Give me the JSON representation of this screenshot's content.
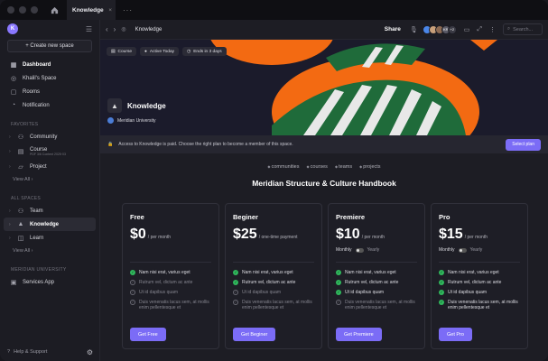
{
  "titlebar": {
    "tab_label": "Knowledge",
    "tab_close": "×",
    "more": "···"
  },
  "sidebar": {
    "avatar_letter": "K",
    "create_label": "+  Create new space",
    "main_items": [
      {
        "label": "Dashboard",
        "icon": "dashboard-icon",
        "glyph": "▦"
      },
      {
        "label": "Khalil's Space",
        "icon": "compass-icon",
        "glyph": "◎"
      },
      {
        "label": "Rooms",
        "icon": "door-icon",
        "glyph": "▢"
      },
      {
        "label": "Notification",
        "icon": "bell-icon",
        "glyph": "◔"
      }
    ],
    "favorites_label": "FAVORITES",
    "favorites": [
      {
        "label": "Community",
        "icon": "users-icon",
        "glyph": "⚇"
      },
      {
        "label": "Course",
        "sub": "PDF 3/6 Content 2025·03",
        "icon": "book-icon",
        "glyph": "▤"
      },
      {
        "label": "Project",
        "icon": "folder-icon",
        "glyph": "▱"
      }
    ],
    "view_all_1": "View All  ›",
    "spaces_label": "ALL SPACES",
    "spaces": [
      {
        "label": "Team",
        "icon": "team-icon",
        "glyph": "⚇"
      },
      {
        "label": "Knowledge",
        "icon": "cap-icon",
        "glyph": "▲"
      },
      {
        "label": "Learn",
        "icon": "learn-icon",
        "glyph": "◫"
      }
    ],
    "view_all_2": "View All  ›",
    "org_label": "MERIDIAN UNIVERSITY",
    "org_items": [
      {
        "label": "Services App",
        "icon": "app-icon",
        "glyph": "▣"
      }
    ],
    "help_label": "Help & Support"
  },
  "topbar": {
    "title": "Knowledge",
    "share": "Share",
    "avatars": [
      {
        "text": "",
        "color": "#4a86e8"
      },
      {
        "text": "",
        "color": "#c9a07a"
      },
      {
        "text": "",
        "color": "#8d6b53"
      },
      {
        "text": "KR",
        "color": "#5a5a66"
      },
      {
        "text": "+2",
        "color": "#3a3a44"
      }
    ],
    "search_placeholder": "Search..."
  },
  "banner": {
    "chips": [
      {
        "label": "Course",
        "glyph": "▤"
      },
      {
        "label": "Active Today",
        "glyph": "●"
      },
      {
        "label": "Ends in 3 days",
        "glyph": "◷"
      }
    ],
    "space_name": "Knowledge",
    "org_name": "Meridian University",
    "colors": {
      "orange": "#f36a12",
      "green": "#1f6b3a",
      "stripe": "#e8e8e8",
      "bg": "#1b1b2b"
    }
  },
  "paid_notice": {
    "text": "Access to Knowledge is paid. Choose the right plan to become a member of this space.",
    "button": "Select plan"
  },
  "categories": [
    "communities",
    "courses",
    "teams",
    "projects"
  ],
  "handbook_title": "Meridian Structure & Culture Handbook",
  "plans": [
    {
      "name": "Free",
      "price": "$0",
      "period": "/ per month",
      "billing_monthly": "",
      "billing_yearly": "",
      "features": [
        {
          "text": "Nam nisi erat, varius eget",
          "on": true
        },
        {
          "text": "Rutrum vel, dictum ac ante",
          "on": false
        },
        {
          "text": "Ut id dapibus quam",
          "on": false
        },
        {
          "text": "Duis venenatis lacus sem, at mollis enim pellentesque et",
          "on": false
        }
      ],
      "button": "Get Free"
    },
    {
      "name": "Beginer",
      "price": "$25",
      "period": "/ one-time payment",
      "billing_monthly": "",
      "billing_yearly": "",
      "features": [
        {
          "text": "Nam nisi erat, varius eget",
          "on": true
        },
        {
          "text": "Rutrum vel, dictum ac ante",
          "on": true
        },
        {
          "text": "Ut id dapibus quam",
          "on": false
        },
        {
          "text": "Duis venenatis lacus sem, at mollis enim pellentesque et",
          "on": false
        }
      ],
      "button": "Get Beginer"
    },
    {
      "name": "Premiere",
      "price": "$10",
      "period": "/ per month",
      "billing_monthly": "Monthly",
      "billing_yearly": "Yearly",
      "features": [
        {
          "text": "Nam nisi erat, varius eget",
          "on": true
        },
        {
          "text": "Rutrum vel, dictum ac ante",
          "on": true
        },
        {
          "text": "Ut id dapibus quam",
          "on": true
        },
        {
          "text": "Duis venenatis lacus sem, at mollis enim pellentesque et",
          "on": false
        }
      ],
      "button": "Get Premiere"
    },
    {
      "name": "Pro",
      "price": "$15",
      "period": "/ per month",
      "billing_monthly": "Monthly",
      "billing_yearly": "Yearly",
      "features": [
        {
          "text": "Nam nisi erat, varius eget",
          "on": true
        },
        {
          "text": "Rutrum vel, dictum ac ante",
          "on": true
        },
        {
          "text": "Ut id dapibus quam",
          "on": true
        },
        {
          "text": "Duis venenatis lacus sem, at mollis enim pellentesque et",
          "on": true
        }
      ],
      "button": "Get Pro"
    }
  ],
  "accent": "#7b6cf6"
}
